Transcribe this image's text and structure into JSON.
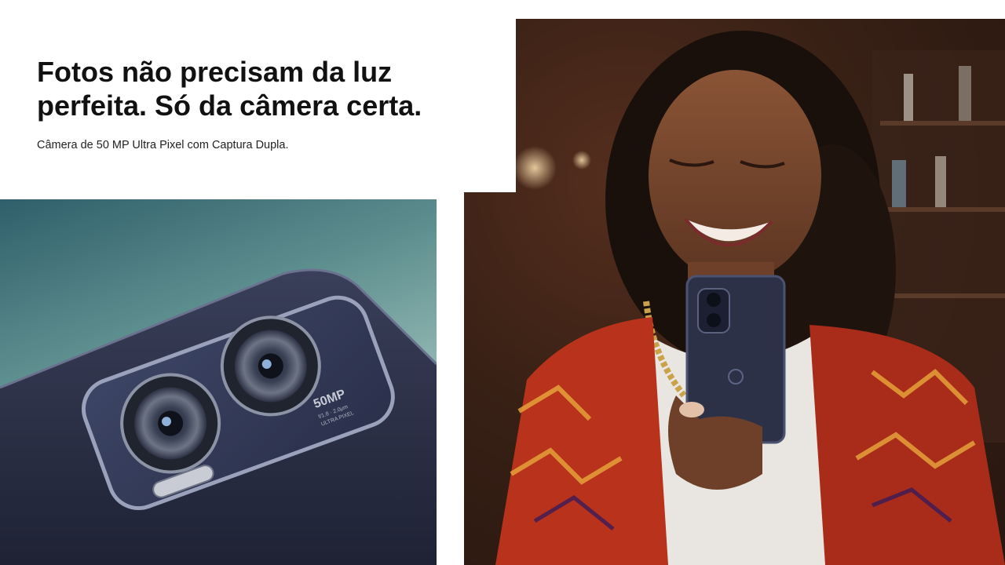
{
  "hero": {
    "title_line1": "Fotos não precisam da luz",
    "title_line2": "perfeita. Só da câmera certa.",
    "subtitle": "Câmera de 50 MP Ultra Pixel com Captura Dupla."
  },
  "camera_photo": {
    "badge_main": "50MP",
    "badge_sub1": "f/1.8 · 2.0μm",
    "badge_sub2": "ULTRA PIXEL"
  },
  "colors": {
    "text": "#111111",
    "phone_body": "#2c3148",
    "jacket_red": "#b8321c"
  }
}
